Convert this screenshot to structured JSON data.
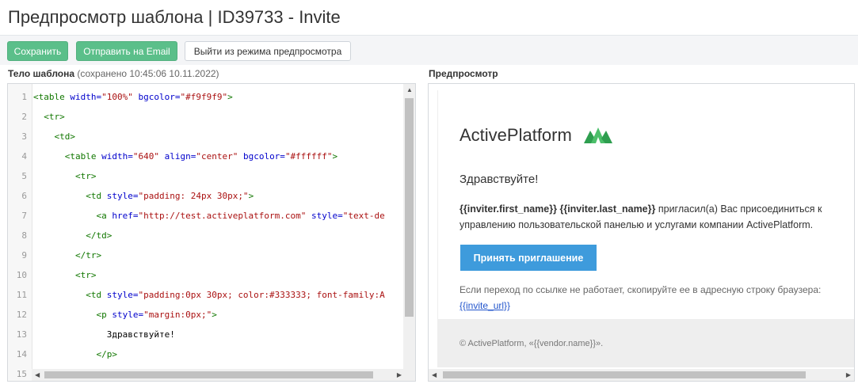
{
  "header": {
    "title": "Предпросмотр шаблона | ID39733 - Invite"
  },
  "toolbar": {
    "save_label": "Сохранить",
    "send_email_label": "Отправить на Email",
    "exit_preview_label": "Выйти из режима предпросмотра",
    "accent_color": "#5bbf8a"
  },
  "editor": {
    "label": "Тело шаблона",
    "saved_note": "(сохранено 10:45:06 10.11.2022)",
    "lines": [
      {
        "n": "1",
        "indent": "",
        "parts": [
          [
            "tag",
            "<table "
          ],
          [
            "att",
            "width="
          ],
          [
            "str",
            "\"100%\""
          ],
          [
            "att",
            " bgcolor="
          ],
          [
            "str",
            "\"#f9f9f9\""
          ],
          [
            "tag",
            ">"
          ]
        ]
      },
      {
        "n": "2",
        "indent": "  ",
        "parts": [
          [
            "tag",
            "<tr>"
          ]
        ]
      },
      {
        "n": "3",
        "indent": "    ",
        "parts": [
          [
            "tag",
            "<td>"
          ]
        ]
      },
      {
        "n": "4",
        "indent": "      ",
        "parts": [
          [
            "tag",
            "<table "
          ],
          [
            "att",
            "width="
          ],
          [
            "str",
            "\"640\""
          ],
          [
            "att",
            " align="
          ],
          [
            "str",
            "\"center\""
          ],
          [
            "att",
            " bgcolor="
          ],
          [
            "str",
            "\"#ffffff\""
          ],
          [
            "tag",
            ">"
          ]
        ]
      },
      {
        "n": "5",
        "indent": "        ",
        "parts": [
          [
            "tag",
            "<tr>"
          ]
        ]
      },
      {
        "n": "6",
        "indent": "          ",
        "parts": [
          [
            "tag",
            "<td "
          ],
          [
            "att",
            "style="
          ],
          [
            "str",
            "\"padding: 24px 30px;\""
          ],
          [
            "tag",
            ">"
          ]
        ]
      },
      {
        "n": "7",
        "indent": "            ",
        "parts": [
          [
            "tag",
            "<a "
          ],
          [
            "att",
            "href="
          ],
          [
            "str",
            "\"http://test.activeplatform.com\""
          ],
          [
            "att",
            " style="
          ],
          [
            "str",
            "\"text-de"
          ]
        ]
      },
      {
        "n": "8",
        "indent": "          ",
        "parts": [
          [
            "tag",
            "</td>"
          ]
        ]
      },
      {
        "n": "9",
        "indent": "        ",
        "parts": [
          [
            "tag",
            "</tr>"
          ]
        ]
      },
      {
        "n": "10",
        "indent": "        ",
        "parts": [
          [
            "tag",
            "<tr>"
          ]
        ]
      },
      {
        "n": "11",
        "indent": "          ",
        "parts": [
          [
            "tag",
            "<td "
          ],
          [
            "att",
            "style="
          ],
          [
            "str",
            "\"padding:0px 30px; color:#333333; font-family:A"
          ]
        ]
      },
      {
        "n": "12",
        "indent": "            ",
        "parts": [
          [
            "tag",
            "<p "
          ],
          [
            "att",
            "style="
          ],
          [
            "str",
            "\"margin:0px;\""
          ],
          [
            "tag",
            ">"
          ]
        ]
      },
      {
        "n": "13",
        "indent": "              ",
        "parts": [
          [
            "txt",
            "Здравствуйте!"
          ]
        ]
      },
      {
        "n": "14",
        "indent": "            ",
        "parts": [
          [
            "tag",
            "</p>"
          ]
        ]
      },
      {
        "n": "15",
        "indent": "",
        "parts": []
      }
    ]
  },
  "preview": {
    "label": "Предпросмотр",
    "logo_text": "ActivePlatform",
    "greeting": "Здравствуйте!",
    "first_name_var": "{{inviter.first_name}}",
    "last_name_var": "{{inviter.last_name}}",
    "invite_text_line1": " пригласил(а) Вас присоединиться к",
    "invite_text_line2": "управлению пользовательской панелью и услугами компании ActivePlatform.",
    "accept_button": "Принять приглашение",
    "hint": "Если переход по ссылке не работает, скопируйте ее в адресную строку браузера:",
    "invite_link": "{{invite_url}}",
    "footer": "© ActivePlatform, «{{vendor.name}}».",
    "button_color": "#3e9bdc"
  }
}
